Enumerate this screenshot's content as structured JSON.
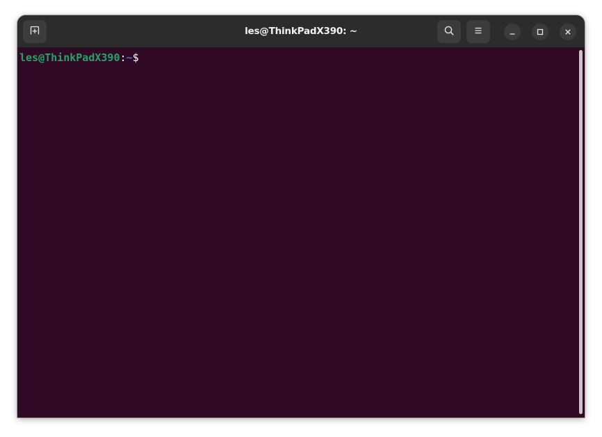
{
  "window": {
    "title": "les@ThinkPadX390: ~"
  },
  "titlebar": {
    "new_tab_icon": "new-tab-icon",
    "search_icon": "search-icon",
    "menu_icon": "hamburger-menu-icon",
    "minimize_icon": "minimize-icon",
    "maximize_icon": "maximize-icon",
    "close_icon": "close-icon"
  },
  "terminal": {
    "prompt_user_host": "les@ThinkPadX390",
    "prompt_separator": ":",
    "prompt_path": "~",
    "prompt_symbol": "$",
    "colors": {
      "background": "#300a24",
      "user_host": "#26a269",
      "path": "#3a6fd4",
      "text": "#ffffff"
    }
  }
}
